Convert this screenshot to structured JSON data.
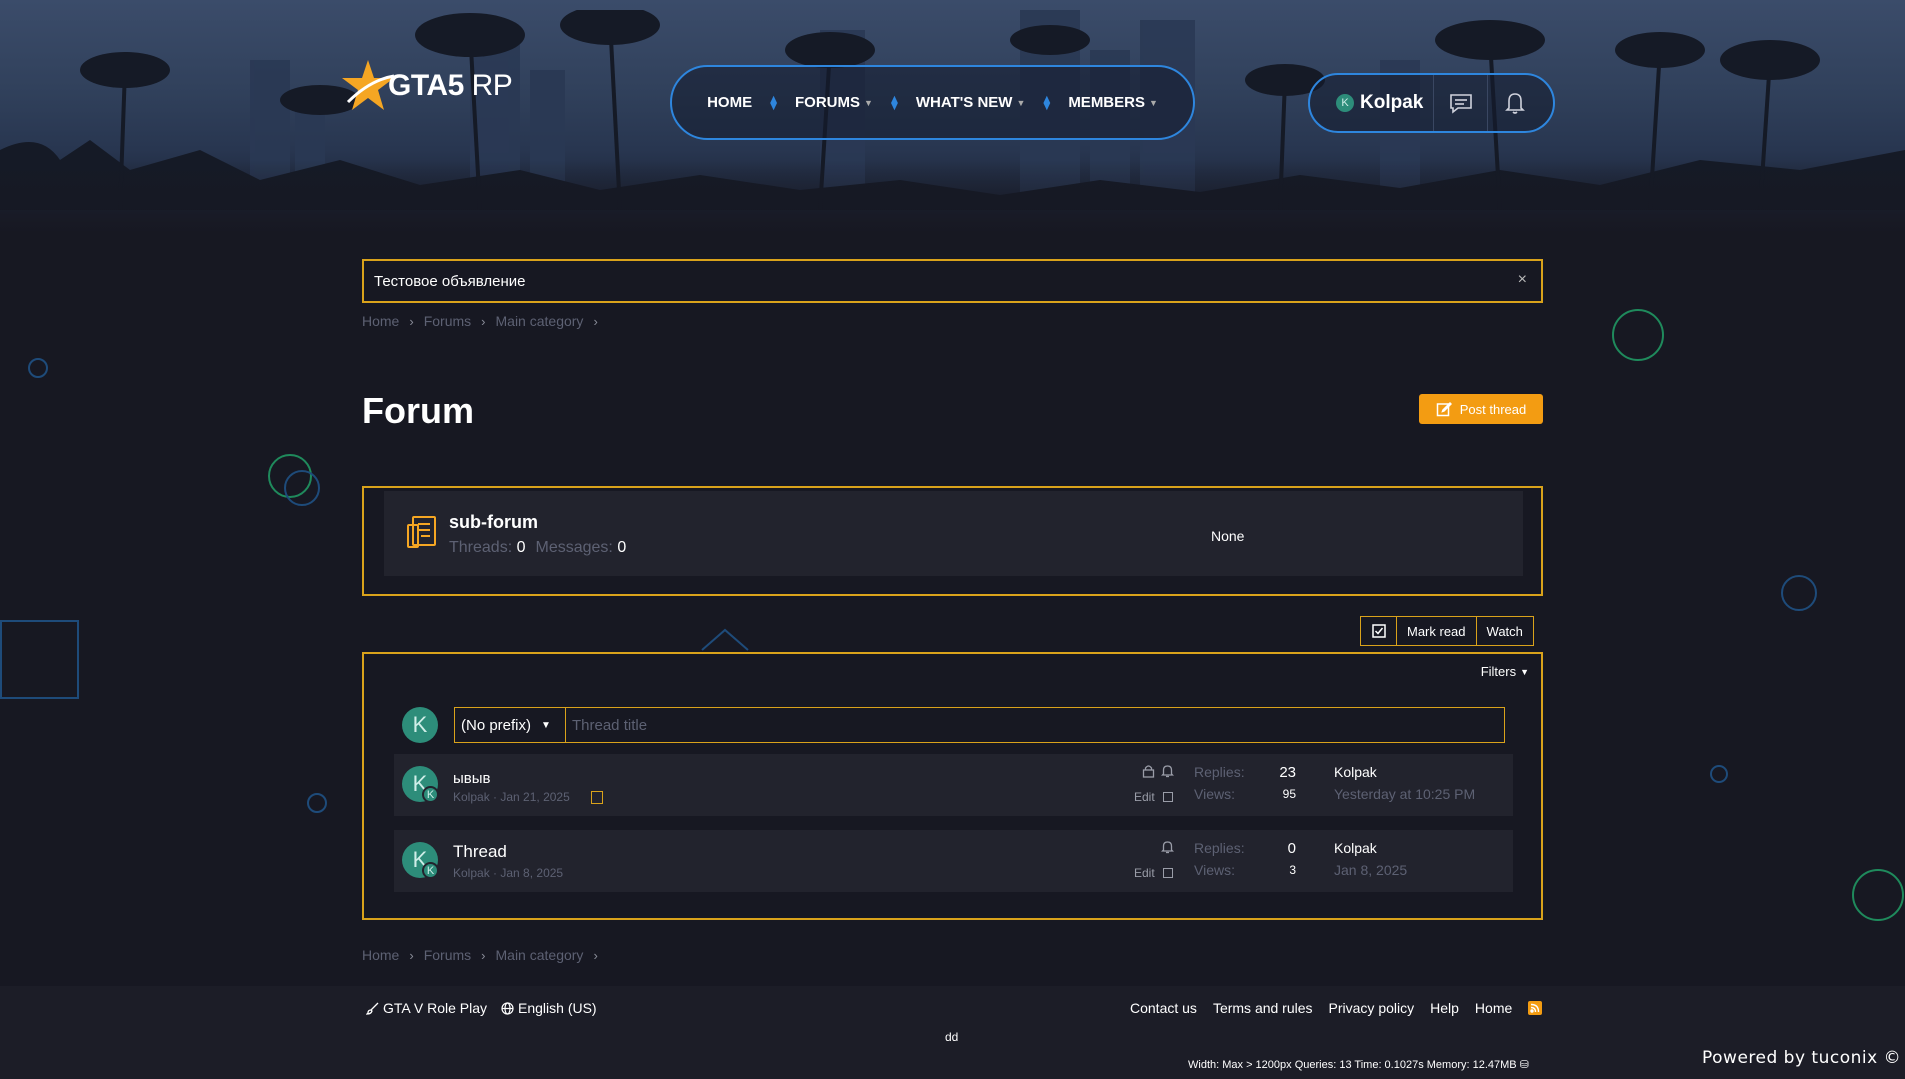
{
  "site": {
    "logo_main": "GTA5",
    "logo_suffix": "RP"
  },
  "nav": {
    "items": [
      {
        "label": "HOME",
        "has_caret": false
      },
      {
        "label": "FORUMS",
        "has_caret": true
      },
      {
        "label": "WHAT'S NEW",
        "has_caret": true
      },
      {
        "label": "MEMBERS",
        "has_caret": true
      }
    ]
  },
  "user": {
    "name": "Kolpak",
    "avatar_letter": "K",
    "icons": [
      "conversations-icon",
      "bell-icon"
    ]
  },
  "notice": {
    "text": "Тестовое объявление",
    "close": "×"
  },
  "breadcrumb": {
    "items": [
      "Home",
      "Forums",
      "Main category"
    ]
  },
  "page": {
    "title": "Forum",
    "post_thread_label": "Post thread"
  },
  "subforum": {
    "title": "sub-forum",
    "threads_label": "Threads:",
    "threads_value": "0",
    "messages_label": "Messages:",
    "messages_value": "0",
    "last_post": "None"
  },
  "actions": {
    "mark_read": "Mark read",
    "watch": "Watch"
  },
  "thread_list": {
    "filters_label": "Filters",
    "prefix_value": "(No prefix)",
    "title_placeholder": "Thread title",
    "composer_avatar": "K",
    "threads": [
      {
        "title": "ывыв",
        "author": "Kolpak",
        "date": "Jan 21, 2025",
        "avatar": "K",
        "badge": "K",
        "locked": true,
        "edit_label": "Edit",
        "replies_label": "Replies:",
        "replies": "23",
        "views_label": "Views:",
        "views": "95",
        "last_user": "Kolpak",
        "last_date": "Yesterday at 10:25 PM"
      },
      {
        "title": "Thread",
        "author": "Kolpak",
        "date": "Jan 8, 2025",
        "avatar": "K",
        "badge": "K",
        "locked": false,
        "edit_label": "Edit",
        "replies_label": "Replies:",
        "replies": "0",
        "views_label": "Views:",
        "views": "3",
        "last_user": "Kolpak",
        "last_date": "Jan 8, 2025"
      }
    ]
  },
  "footer": {
    "style_name": "GTA V Role Play",
    "language": "English (US)",
    "links": [
      "Contact us",
      "Terms and rules",
      "Privacy policy",
      "Help",
      "Home"
    ],
    "custom_text": "dd",
    "debug": "Width: Max > 1200px Queries: 13 Time: 0.1027s Memory: 12.47MB",
    "powered_by": "Powered by tuconix ©"
  },
  "colors": {
    "accent_gold": "#d9a21b",
    "accent_blue": "#2e86de",
    "button_orange": "#f39c12",
    "avatar_teal": "#2d8d7a",
    "background": "#171822"
  }
}
